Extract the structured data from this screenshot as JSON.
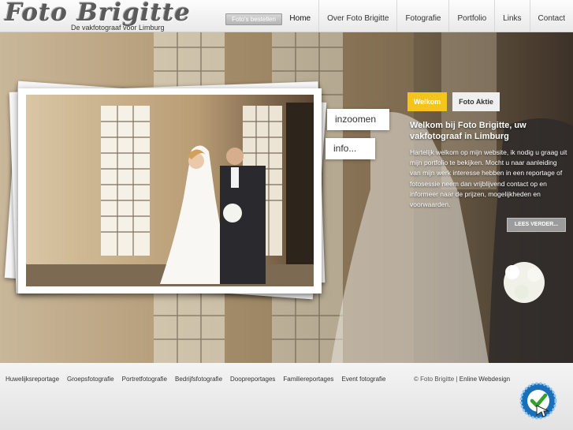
{
  "logo": {
    "title": "Foto Brigitte",
    "subtitle": "De vakfotograaf voor Limburg"
  },
  "header": {
    "order_label": "Foto's bestellen"
  },
  "nav": {
    "items": [
      {
        "label": "Home",
        "active": true
      },
      {
        "label": "Over Foto Brigitte"
      },
      {
        "label": "Fotografie"
      },
      {
        "label": "Portfolio"
      },
      {
        "label": "Links"
      },
      {
        "label": "Contact"
      }
    ]
  },
  "hero": {
    "zoom_label": "inzoomen",
    "info_label": "info...",
    "tabs": {
      "welkom": "Welkom",
      "aktie": "Foto Aktie"
    },
    "welcome_title": "Welkom bij Foto Brigitte, uw vakfotograaf in Limburg",
    "welcome_text": "Hartelijk welkom op mijn website, ik nodig u graag uit mijn portfolio te bekijken. Mocht u naar aanleiding van mijn werk interesse hebben in een reportage of fotosessie neem dan vrijblijvend contact op en informeer naar de prijzen, mogelijkheden en voorwaarden.",
    "more_label": "LEES VERDER..."
  },
  "footer": {
    "links": [
      "Huwelijksreportage",
      "Groepsfotografie",
      "Portretfotografie",
      "Bedrijfsfotografie",
      "Doopreportages",
      "Familiereportages",
      "Event fotografie"
    ],
    "copyright_prefix": "© Foto Brigitte | ",
    "copyright_link": "Enline Webdesign"
  },
  "colors": {
    "accent": "#f3c51c",
    "button_grey": "#9c9c9c"
  },
  "icons": {
    "badge": "checkmark-badge-icon"
  }
}
